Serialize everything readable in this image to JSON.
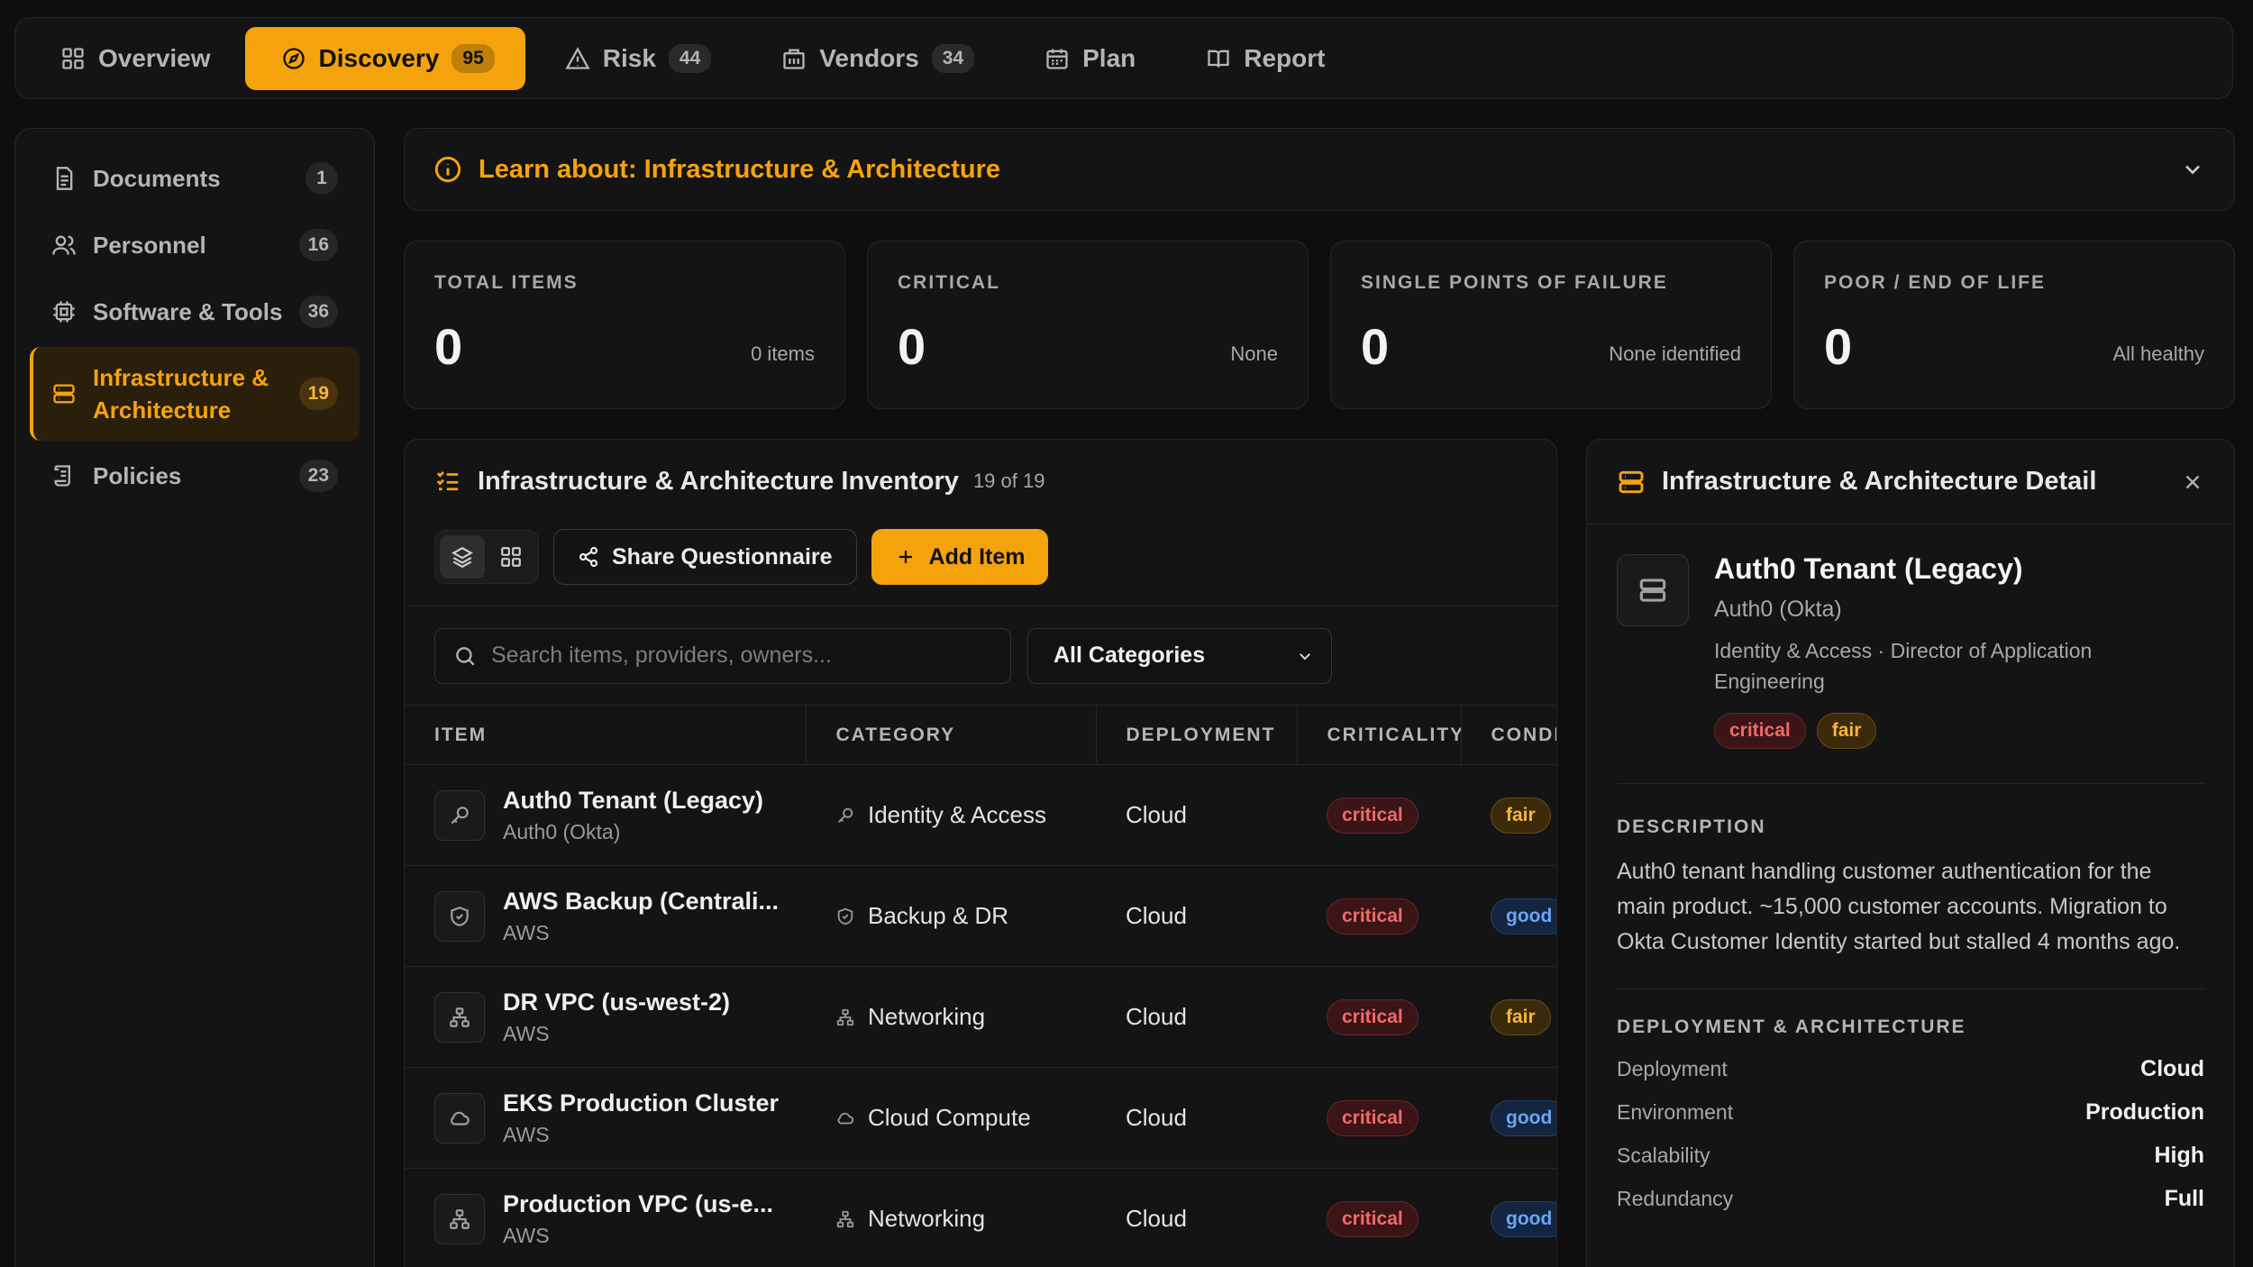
{
  "nav": {
    "tabs": [
      {
        "label": "Overview",
        "icon": "grid-icon"
      },
      {
        "label": "Discovery",
        "count": "95",
        "icon": "compass-icon"
      },
      {
        "label": "Risk",
        "count": "44",
        "icon": "warning-icon"
      },
      {
        "label": "Vendors",
        "count": "34",
        "icon": "building-icon"
      },
      {
        "label": "Plan",
        "icon": "calendar-icon"
      },
      {
        "label": "Report",
        "icon": "book-icon"
      }
    ],
    "active": "Discovery"
  },
  "sidebar": {
    "items": [
      {
        "label": "Documents",
        "count": "1",
        "icon": "document-icon"
      },
      {
        "label": "Personnel",
        "count": "16",
        "icon": "users-icon"
      },
      {
        "label": "Software & Tools",
        "count": "36",
        "icon": "chip-icon"
      },
      {
        "label": "Infrastructure & Architecture",
        "count": "19",
        "icon": "server-icon"
      },
      {
        "label": "Policies",
        "count": "23",
        "icon": "scroll-icon"
      }
    ],
    "active": "Infrastructure & Architecture"
  },
  "learn": {
    "title": "Learn about: Infrastructure & Architecture"
  },
  "stats": [
    {
      "label": "TOTAL ITEMS",
      "value": "0",
      "sub": "0 items"
    },
    {
      "label": "CRITICAL",
      "value": "0",
      "sub": "None"
    },
    {
      "label": "SINGLE POINTS OF FAILURE",
      "value": "0",
      "sub": "None identified"
    },
    {
      "label": "POOR / END OF LIFE",
      "value": "0",
      "sub": "All healthy"
    }
  ],
  "inventory": {
    "title": "Infrastructure & Architecture Inventory",
    "count": "19 of 19",
    "share_label": "Share Questionnaire",
    "add_label": "Add Item",
    "search_placeholder": "Search items, providers, owners...",
    "category_filter": "All Categories",
    "columns": [
      "ITEM",
      "CATEGORY",
      "DEPLOYMENT",
      "CRITICALITY",
      "CONDITION"
    ],
    "rows": [
      {
        "name": "Auth0 Tenant (Legacy)",
        "provider": "Auth0 (Okta)",
        "category": "Identity & Access",
        "deployment": "Cloud",
        "criticality": "critical",
        "condition": "fair",
        "icon": "key-icon"
      },
      {
        "name": "AWS Backup (Centrali...",
        "provider": "AWS",
        "category": "Backup & DR",
        "deployment": "Cloud",
        "criticality": "critical",
        "condition": "good",
        "icon": "shield-icon"
      },
      {
        "name": "DR VPC (us-west-2)",
        "provider": "AWS",
        "category": "Networking",
        "deployment": "Cloud",
        "criticality": "critical",
        "condition": "fair",
        "icon": "network-icon"
      },
      {
        "name": "EKS Production Cluster",
        "provider": "AWS",
        "category": "Cloud Compute",
        "deployment": "Cloud",
        "criticality": "critical",
        "condition": "good",
        "icon": "cloud-icon"
      },
      {
        "name": "Production VPC (us-e...",
        "provider": "AWS",
        "category": "Networking",
        "deployment": "Cloud",
        "criticality": "critical",
        "condition": "good",
        "icon": "network-icon"
      }
    ]
  },
  "detail": {
    "panel_title": "Infrastructure & Architecture Detail",
    "name": "Auth0 Tenant (Legacy)",
    "provider": "Auth0 (Okta)",
    "meta": "Identity & Access · Director of Application Engineering",
    "criticality": "critical",
    "condition": "fair",
    "description_label": "DESCRIPTION",
    "description": "Auth0 tenant handling customer authentication for the main product. ~15,000 customer accounts. Migration to Okta Customer Identity started but stalled 4 months ago.",
    "deploy_label": "DEPLOYMENT & ARCHITECTURE",
    "fields": [
      {
        "key": "Deployment",
        "value": "Cloud"
      },
      {
        "key": "Environment",
        "value": "Production"
      },
      {
        "key": "Scalability",
        "value": "High"
      },
      {
        "key": "Redundancy",
        "value": "Full"
      }
    ]
  },
  "colors": {
    "accent": "#f5a30c",
    "critical": "#f06a6a",
    "fair": "#f5b53c",
    "good": "#6aa6f5",
    "background": "#0e0e0e"
  }
}
